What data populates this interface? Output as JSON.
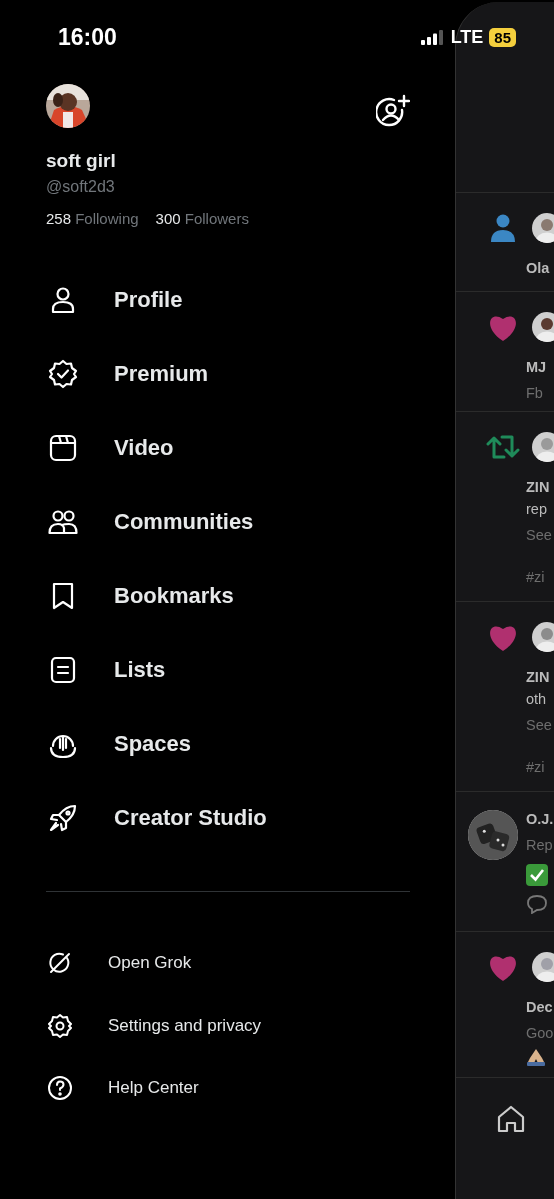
{
  "status_bar": {
    "time": "16:00",
    "network": "LTE",
    "battery": "85"
  },
  "profile": {
    "name": "soft girl",
    "handle": "@soft2d3",
    "following_count": "258",
    "following_label": "Following",
    "followers_count": "300",
    "followers_label": "Followers"
  },
  "menu": [
    {
      "label": "Profile",
      "kind": "profile"
    },
    {
      "label": "Premium",
      "kind": "premium"
    },
    {
      "label": "Video",
      "kind": "video"
    },
    {
      "label": "Communities",
      "kind": "communities"
    },
    {
      "label": "Bookmarks",
      "kind": "bookmarks"
    },
    {
      "label": "Lists",
      "kind": "lists"
    },
    {
      "label": "Spaces",
      "kind": "spaces"
    },
    {
      "label": "Creator Studio",
      "kind": "creator"
    }
  ],
  "secondary_menu": [
    {
      "label": "Open Grok",
      "kind": "grok"
    },
    {
      "label": "Settings and privacy",
      "kind": "settings"
    },
    {
      "label": "Help Center",
      "kind": "help"
    }
  ],
  "feed_preview": [
    {
      "kind": "follow",
      "lines": [
        {
          "text": "Ola",
          "kind": "bold"
        }
      ]
    },
    {
      "kind": "like",
      "lines": [
        {
          "text": "MJ",
          "kind": "bold"
        },
        {
          "text": "Fb",
          "kind": "muted"
        }
      ]
    },
    {
      "kind": "repost",
      "lines": [
        {
          "text": "ZIN",
          "kind": "bold"
        },
        {
          "text": "rep",
          "kind": "body"
        },
        {
          "text": "See",
          "kind": "muted"
        },
        {
          "text": "#zi",
          "kind": "gap"
        }
      ]
    },
    {
      "kind": "like",
      "lines": [
        {
          "text": "ZIN",
          "kind": "bold"
        },
        {
          "text": "oth",
          "kind": "body"
        },
        {
          "text": "See",
          "kind": "muted"
        },
        {
          "text": "#zi",
          "kind": "gap"
        }
      ]
    },
    {
      "kind": "reply",
      "lines": [
        {
          "text": "O.J.",
          "kind": "bold"
        },
        {
          "text": "Rep",
          "kind": "muted"
        }
      ]
    },
    {
      "kind": "like",
      "lines": [
        {
          "text": "Dec",
          "kind": "bold"
        },
        {
          "text": "Goo",
          "kind": "muted"
        }
      ]
    }
  ],
  "bottom_nav": [
    {
      "kind": "home"
    }
  ]
}
